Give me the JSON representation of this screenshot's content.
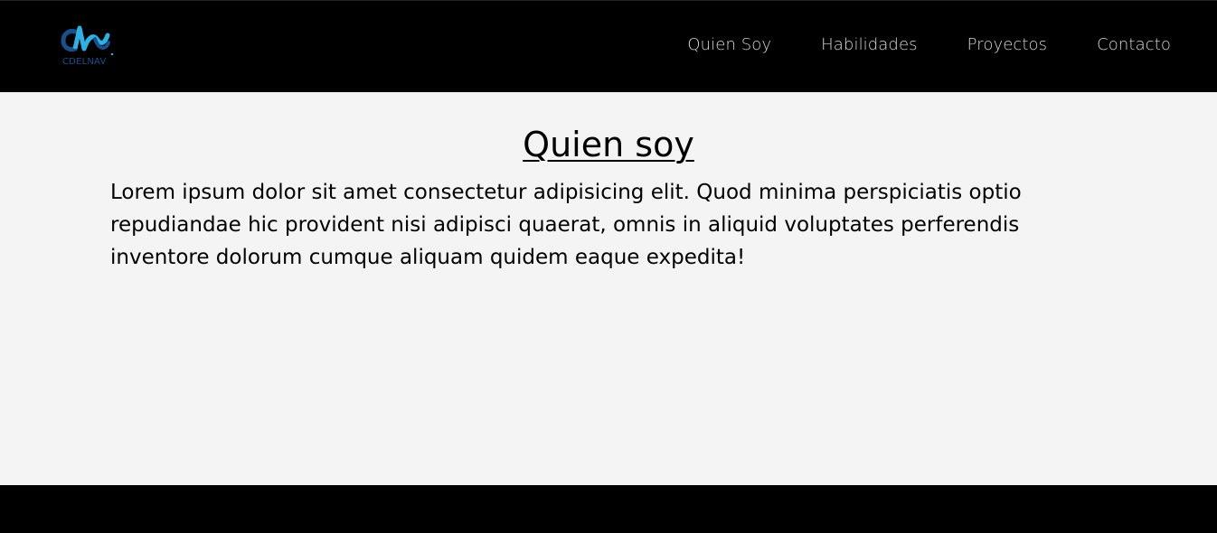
{
  "brand": {
    "name": "CDELNAV"
  },
  "nav": {
    "items": [
      {
        "label": "Quien Soy"
      },
      {
        "label": "Habilidades"
      },
      {
        "label": "Proyectos"
      },
      {
        "label": "Contacto"
      }
    ]
  },
  "about": {
    "title": "Quien soy",
    "body": "Lorem ipsum dolor sit amet consectetur adipisicing elit. Quod minima perspiciatis optio repudiandae hic provident nisi adipisci quaerat, omnis in aliquid voluptates perferendis inventore dolorum cumque aliquam quidem eaque expedita!"
  },
  "colors": {
    "header_background": "#000000",
    "page_background": "#f4f4f4",
    "logo_primary": "#1b4f8a",
    "logo_accent": "#2bb3e6",
    "nav_text": "#d8d8d8",
    "body_text": "#000000"
  }
}
